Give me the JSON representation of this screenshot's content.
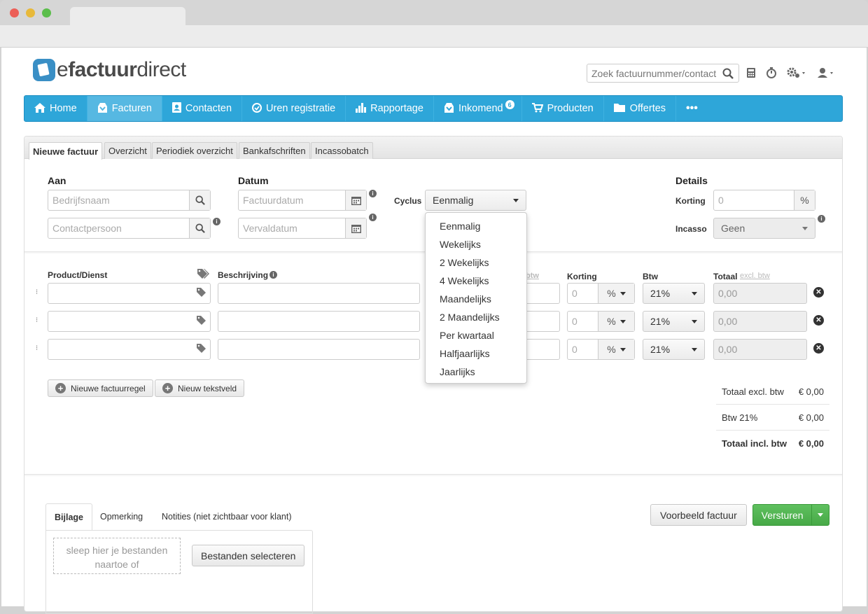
{
  "search": {
    "placeholder": "Zoek factuurnummer/contact"
  },
  "logo": {
    "part1": "e",
    "part2": "factuur",
    "part3": "direct"
  },
  "nav": [
    {
      "label": "Home",
      "icon": "home-icon"
    },
    {
      "label": "Facturen",
      "icon": "inbox-icon",
      "active": true
    },
    {
      "label": "Contacten",
      "icon": "contact-card-icon"
    },
    {
      "label": "Uren registratie",
      "icon": "clock-icon"
    },
    {
      "label": "Rapportage",
      "icon": "bar-chart-icon"
    },
    {
      "label": "Inkomend",
      "icon": "inbox-icon",
      "badge": "6"
    },
    {
      "label": "Producten",
      "icon": "cart-icon"
    },
    {
      "label": "Offertes",
      "icon": "folder-icon"
    },
    {
      "label": "•••",
      "icon": "more-icon"
    }
  ],
  "subtabs": [
    "Nieuwe factuur",
    "Overzicht",
    "Periodiek overzicht",
    "Bankafschriften",
    "Incassobatch"
  ],
  "form": {
    "aan": "Aan",
    "datum": "Datum",
    "details": "Details",
    "bedrijfsnaam_ph": "Bedrijfsnaam",
    "contactpersoon_ph": "Contactpersoon",
    "factuurdatum_ph": "Factuurdatum",
    "vervaldatum_ph": "Vervaldatum",
    "cyclus_label": "Cyclus",
    "cyclus_value": "Eenmalig",
    "korting_label": "Korting",
    "korting_value": "0",
    "korting_unit": "%",
    "incasso_label": "Incasso",
    "incasso_value": "Geen"
  },
  "lines": {
    "headers": {
      "product": "Product/Dienst",
      "beschrijving": "Beschrijving",
      "btw_partial": "btw",
      "korting": "Korting",
      "btw": "Btw",
      "totaal": "Totaal",
      "excl": "excl. btw"
    },
    "rows": [
      {
        "korting": "0",
        "unit": "%",
        "btw": "21%",
        "totaal": "0,00"
      },
      {
        "korting": "0",
        "unit": "%",
        "btw": "21%",
        "totaal": "0,00"
      },
      {
        "korting": "0",
        "unit": "%",
        "btw": "21%",
        "totaal": "0,00"
      }
    ]
  },
  "buttons": {
    "nieuwe_regel": "Nieuwe factuurregel",
    "nieuw_tekstveld": "Nieuw tekstveld",
    "voorbeeld": "Voorbeeld factuur",
    "versturen": "Versturen",
    "bestanden": "Bestanden selecteren"
  },
  "totals": [
    {
      "label": "Totaal excl. btw",
      "value": "€ 0,00"
    },
    {
      "label": "Btw 21%",
      "value": "€ 0,00"
    },
    {
      "label": "Totaal incl. btw",
      "value": "€ 0,00"
    }
  ],
  "bottom_tabs": [
    "Bijlage",
    "Opmerking",
    "Notities (niet zichtbaar voor klant)"
  ],
  "dropzone_text_1": "sleep hier je bestanden",
  "dropzone_text_2": "naartoe of",
  "cyclus_options": [
    "Eenmalig",
    "Wekelijks",
    "2 Wekelijks",
    "4 Wekelijks",
    "Maandelijks",
    "2 Maandelijks",
    "Per kwartaal",
    "Halfjaarlijks",
    "Jaarlijks"
  ],
  "colors": {
    "nav": "#2ea6d9",
    "send": "#4cae4c"
  }
}
